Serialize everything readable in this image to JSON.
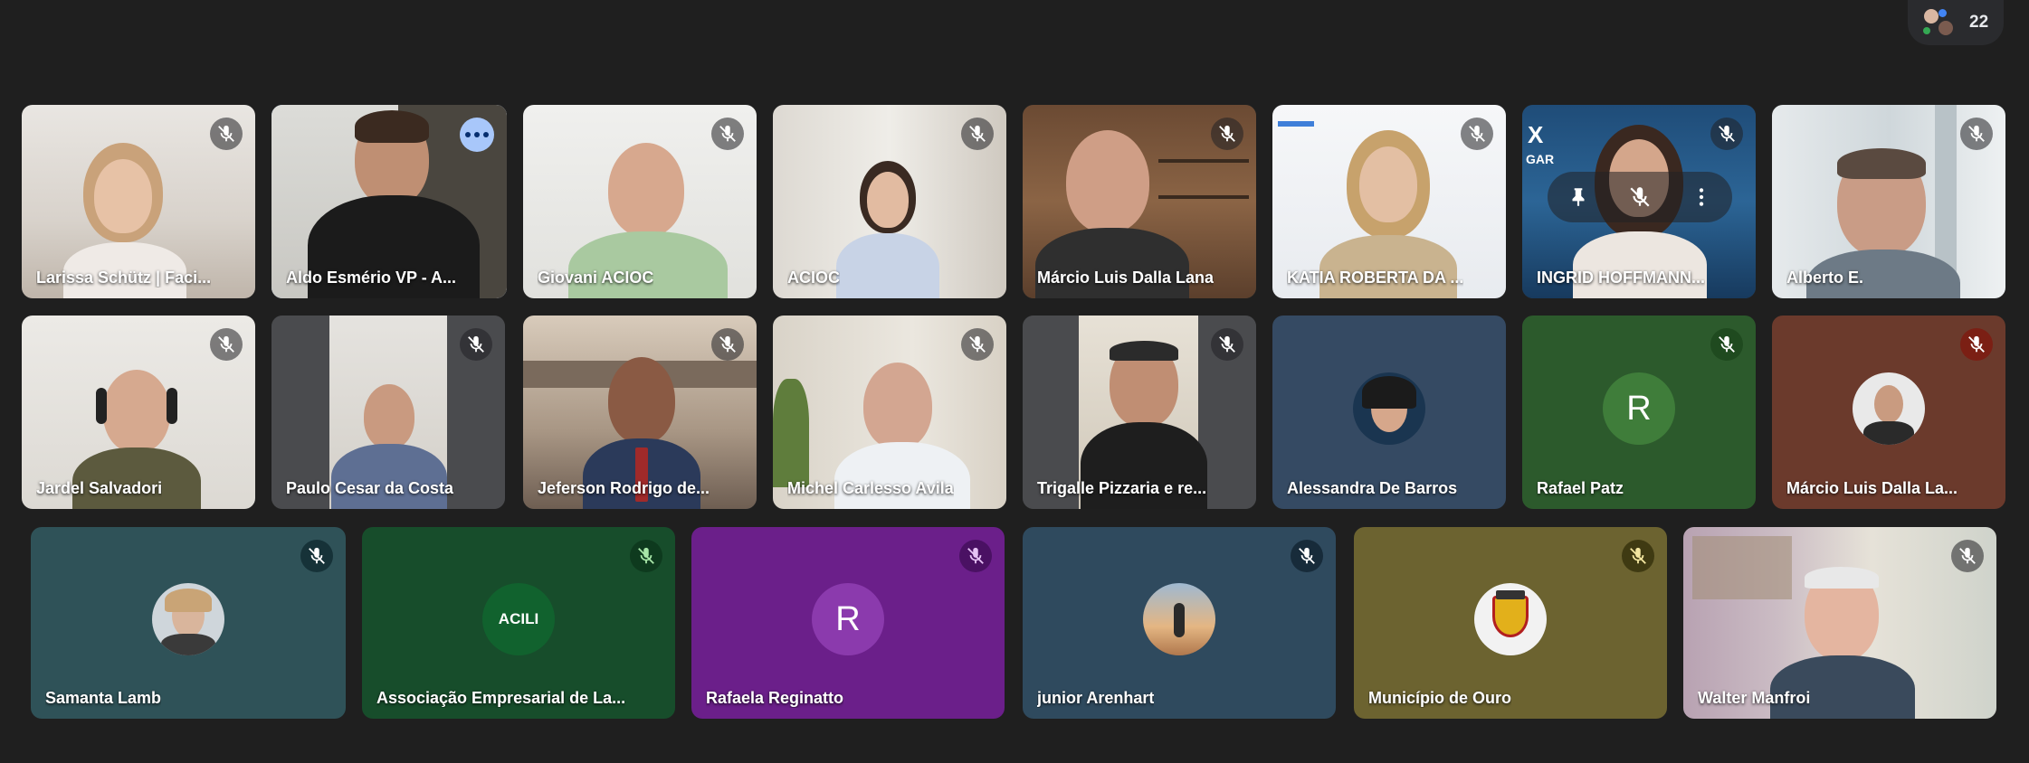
{
  "participants_count": "22",
  "colors": {
    "background": "#1f1f1f",
    "active_speaker_outline": "#a8c7fa"
  },
  "tiles": [
    {
      "name": "Larissa Schütz | Faci...",
      "muted": true
    },
    {
      "name": "Aldo Esmério VP - A...",
      "muted": false,
      "pinned_menu": true
    },
    {
      "name": "Giovani ACIOC",
      "muted": true
    },
    {
      "name": "ACIOC",
      "muted": true
    },
    {
      "name": "Márcio Luis Dalla Lana",
      "muted": true
    },
    {
      "name": "KATIA ROBERTA DA ...",
      "muted": true
    },
    {
      "name": "INGRID HOFFMANN...",
      "muted": true
    },
    {
      "name": "Alberto E.",
      "muted": true
    },
    {
      "name": "Jardel Salvadori",
      "muted": true
    },
    {
      "name": "Paulo Cesar da Costa",
      "muted": true
    },
    {
      "name": "Jeferson Rodrigo de...",
      "muted": true
    },
    {
      "name": "Michel Carlesso Avila",
      "muted": true
    },
    {
      "name": "Trigalle Pizzaria e re...",
      "muted": true
    },
    {
      "name": "Alessandra De Barros",
      "muted": false
    },
    {
      "name": "Rafael Patz",
      "muted": true,
      "initial": "R"
    },
    {
      "name": "Márcio Luis Dalla La...",
      "muted": true
    },
    {
      "name": "Samanta Lamb",
      "muted": true
    },
    {
      "name": "Associação Empresarial de La...",
      "muted": true,
      "logo_text": "ACILI"
    },
    {
      "name": "Rafaela Reginatto",
      "muted": true,
      "initial": "R"
    },
    {
      "name": "junior Arenhart",
      "muted": true
    },
    {
      "name": "Município de Ouro",
      "muted": true
    },
    {
      "name": "Walter Manfroi",
      "muted": true
    }
  ],
  "partial_background_text": {
    "tile_7_left": "X",
    "tile_7_logo": "GAR"
  }
}
